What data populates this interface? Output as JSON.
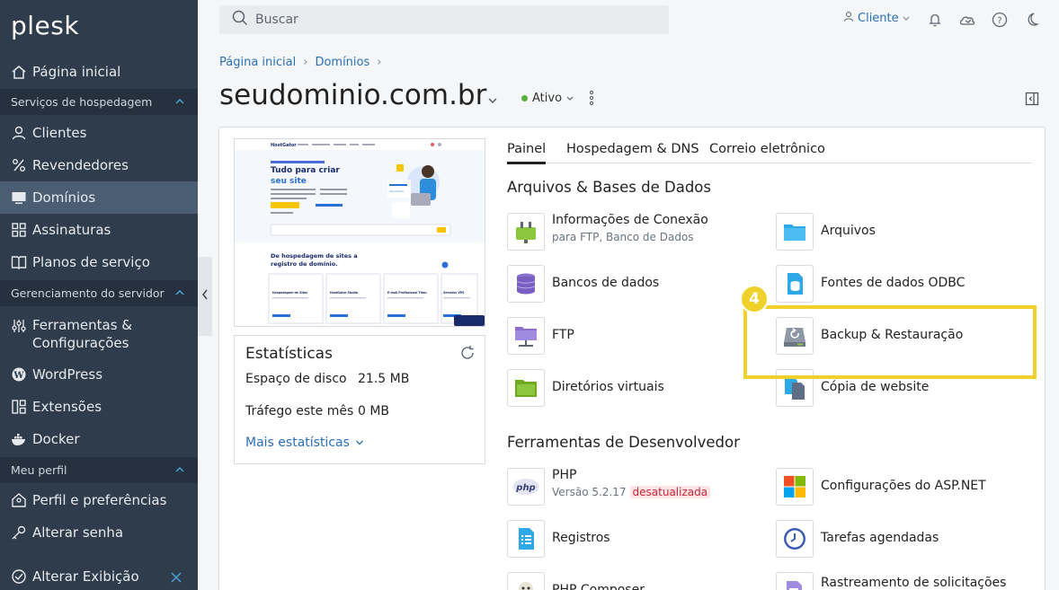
{
  "sidebar": {
    "logo": "plesk",
    "home": "Página inicial",
    "sections": [
      {
        "label": "Serviços de hospedagem",
        "items": [
          "Clientes",
          "Revendedores",
          "Domínios",
          "Assinaturas",
          "Planos de serviço"
        ]
      },
      {
        "label": "Gerenciamento do servidor",
        "items": [
          "Ferramentas & Configurações",
          "WordPress",
          "Extensões",
          "Docker"
        ]
      },
      {
        "label": "Meu perfil",
        "items": [
          "Perfil e preferências",
          "Alterar senha"
        ]
      }
    ],
    "tools_line1": "Ferramentas &",
    "tools_line2": "Configurações",
    "change_view": "Alterar Exibição",
    "active_item": "Domínios"
  },
  "topbar": {
    "search_placeholder": "Buscar",
    "user_label": "Cliente"
  },
  "breadcrumb": [
    "Página inicial",
    "Domínios"
  ],
  "domain": {
    "name": "seudominio.com.br",
    "status": "Ativo"
  },
  "stats": {
    "title": "Estatísticas",
    "disk_label": "Espaço de disco",
    "disk_value": "21.5 MB",
    "traffic_label": "Tráfego este mês",
    "traffic_value": "0 MB",
    "more_link": "Mais estatísticas"
  },
  "tabs": [
    "Painel",
    "Hospedagem & DNS",
    "Correio eletrônico"
  ],
  "sections": {
    "files": {
      "title": "Arquivos & Bases de Dados",
      "tools": [
        {
          "label": "Informações de Conexão",
          "sub": "para FTP, Banco de Dados",
          "icon": "plug-icon"
        },
        {
          "label": "Arquivos",
          "icon": "folder-icon"
        },
        {
          "label": "Bancos de dados",
          "icon": "database-icon"
        },
        {
          "label": "Fontes de dados ODBC",
          "icon": "odbc-icon"
        },
        {
          "label": "FTP",
          "icon": "ftp-folder-icon"
        },
        {
          "label": "Backup & Restauração",
          "icon": "backup-icon"
        },
        {
          "label": "Diretórios virtuais",
          "icon": "virtual-dir-icon"
        },
        {
          "label": "Cópia de website",
          "icon": "copy-website-icon"
        }
      ]
    },
    "dev": {
      "title": "Ferramentas de Desenvolvedor",
      "tools": [
        {
          "label": "PHP",
          "sub": "Versão 5.2.17",
          "badge": "desatualizada",
          "icon": "php-icon"
        },
        {
          "label": "Configurações do ASP.NET",
          "icon": "windows-icon"
        },
        {
          "label": "Registros",
          "icon": "logs-icon"
        },
        {
          "label": "Tarefas agendadas",
          "icon": "clock-icon"
        },
        {
          "label": "PHP Composer",
          "icon": "composer-icon"
        },
        {
          "label": "Rastreamento de solicitações",
          "icon": "tracking-icon"
        }
      ]
    }
  },
  "annotation": {
    "step": "4",
    "color": "#f0d02a"
  },
  "preview": {
    "brand": "HostGator",
    "headline_1": "Tudo para criar",
    "headline_2": "seu site",
    "sub_headline_1": "De hospedagem de sites a",
    "sub_headline_2": "registro de domínio.",
    "products": [
      "Hospedagem de Sites",
      "HostGator Studio",
      "E-mail Profissional Titan",
      "Servidor VPS"
    ]
  }
}
